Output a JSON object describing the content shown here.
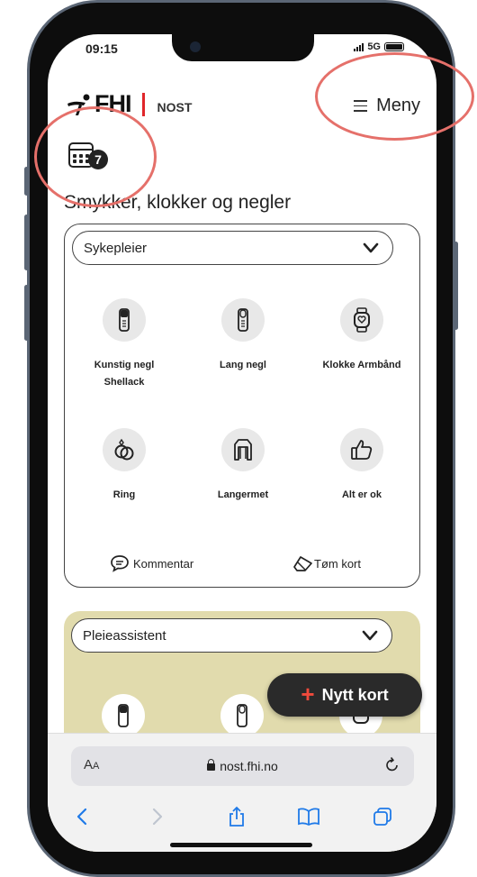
{
  "status_bar": {
    "time": "09:15",
    "network": "5G"
  },
  "header": {
    "logo_text": "FHI",
    "logo_sub": "NOST",
    "menu_label": "Meny"
  },
  "card_counter": {
    "count": "7"
  },
  "page_title": "Smykker, klokker og negler",
  "panels": [
    {
      "role": "Sykepleier",
      "items": [
        {
          "label": "Kunstig negl",
          "label2": "Shellack",
          "icon": "artificial-nail-icon"
        },
        {
          "label": "Lang negl",
          "icon": "long-nail-icon"
        },
        {
          "label": "Klokke Armbånd",
          "icon": "watch-icon"
        },
        {
          "label": "Ring",
          "icon": "ring-icon"
        },
        {
          "label": "Langermet",
          "icon": "long-sleeve-icon"
        },
        {
          "label": "Alt er ok",
          "icon": "thumbs-up-icon"
        }
      ],
      "comment_label": "Kommentar",
      "clear_label": "Tøm kort"
    },
    {
      "role": "Pleieassistent"
    }
  ],
  "fab_label": "Nytt kort",
  "browser": {
    "url": "nost.fhi.no",
    "text_size": "AA"
  },
  "colors": {
    "accent_red": "#e0262a",
    "olive_panel": "#e1dbad",
    "fab": "#2a2a2a",
    "browser_blue": "#1f7ae8",
    "annotation": "#e5706a"
  }
}
